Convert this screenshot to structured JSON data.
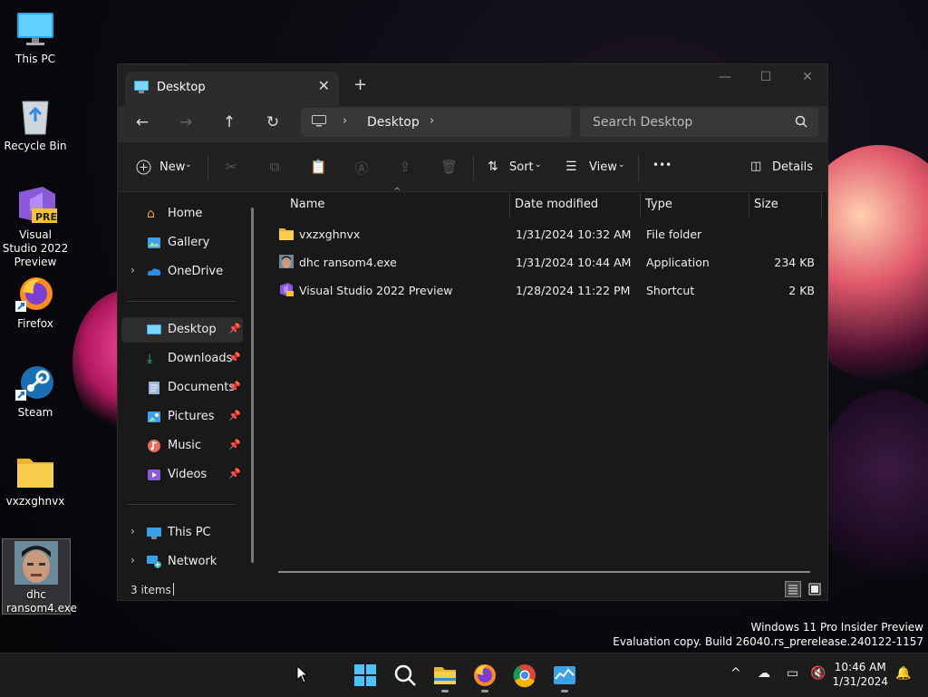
{
  "desktop": {
    "icons": [
      {
        "label": "This PC"
      },
      {
        "label": "Recycle Bin"
      },
      {
        "label": "Visual Studio 2022 Preview",
        "badge": "PRE"
      },
      {
        "label": "Firefox"
      },
      {
        "label": "Steam"
      },
      {
        "label": "vxzxghnvx"
      },
      {
        "label": "dhc ransom4.exe"
      }
    ]
  },
  "window": {
    "tab_title": "Desktop",
    "address": {
      "crumb": "Desktop"
    },
    "search_placeholder": "Search Desktop",
    "toolbar": {
      "new_label": "New",
      "sort_label": "Sort",
      "view_label": "View",
      "details_label": "Details",
      "more_label": "•••"
    },
    "nav": [
      {
        "label": "Home"
      },
      {
        "label": "Gallery"
      },
      {
        "label": "OneDrive"
      },
      {
        "label": "Desktop"
      },
      {
        "label": "Downloads"
      },
      {
        "label": "Documents"
      },
      {
        "label": "Pictures"
      },
      {
        "label": "Music"
      },
      {
        "label": "Videos"
      },
      {
        "label": "This PC"
      },
      {
        "label": "Network"
      }
    ],
    "columns": [
      "Name",
      "Date modified",
      "Type",
      "Size"
    ],
    "files": [
      {
        "name": "vxzxghnvx",
        "date": "1/31/2024 10:32 AM",
        "type": "File folder",
        "size": "",
        "icon": "folder-icon"
      },
      {
        "name": "dhc ransom4.exe",
        "date": "1/31/2024 10:44 AM",
        "type": "Application",
        "size": "234 KB",
        "icon": "exe-icon"
      },
      {
        "name": "Visual Studio 2022 Preview",
        "date": "1/28/2024 11:22 PM",
        "type": "Shortcut",
        "size": "2 KB",
        "icon": "vs-icon"
      }
    ],
    "status": "3 items"
  },
  "watermark": {
    "line1": "Windows 11 Pro Insider Preview",
    "line2": "Evaluation copy. Build 26040.rs_prerelease.240122-1157"
  },
  "clock": {
    "time": "10:46 AM",
    "date": "1/31/2024"
  },
  "colors": {
    "accent": "#60cdff",
    "folder": "#f5c542"
  }
}
